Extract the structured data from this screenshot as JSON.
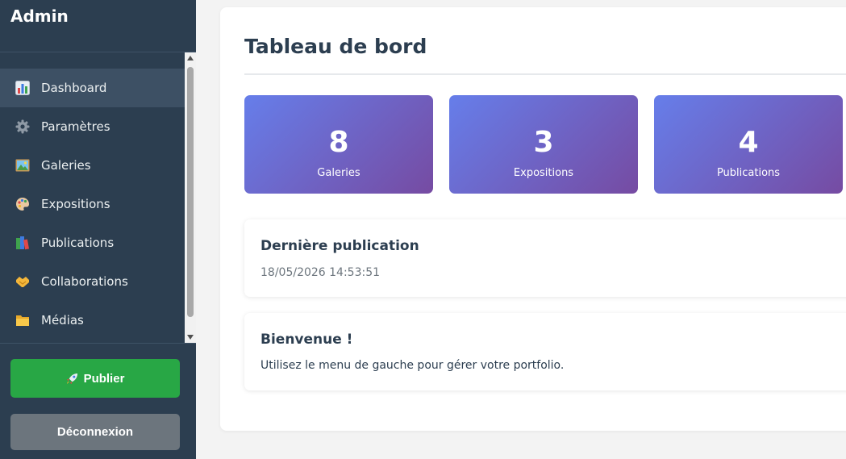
{
  "sidebar": {
    "brand": "Admin",
    "items": [
      {
        "label": "Dashboard",
        "icon": "bar-chart-icon",
        "active": true
      },
      {
        "label": "Paramètres",
        "icon": "gear-icon",
        "active": false
      },
      {
        "label": "Galeries",
        "icon": "picture-icon",
        "active": false
      },
      {
        "label": "Expositions",
        "icon": "palette-icon",
        "active": false
      },
      {
        "label": "Publications",
        "icon": "books-icon",
        "active": false
      },
      {
        "label": "Collaborations",
        "icon": "handshake-icon",
        "active": false
      },
      {
        "label": "Médias",
        "icon": "folder-icon",
        "active": false
      }
    ],
    "publish_label": "Publier",
    "publish_icon": "rocket-icon",
    "logout_label": "Déconnexion"
  },
  "main": {
    "title": "Tableau de bord",
    "stats": [
      {
        "value": "8",
        "label": "Galeries"
      },
      {
        "value": "3",
        "label": "Expositions"
      },
      {
        "value": "4",
        "label": "Publications"
      }
    ],
    "last_publication": {
      "title": "Dernière publication",
      "date": "18/05/2026 14:53:51"
    },
    "welcome": {
      "title": "Bienvenue !",
      "text": "Utilisez le menu de gauche pour gérer votre portfolio."
    }
  },
  "colors": {
    "sidebar_bg": "#2c3e50",
    "sidebar_active": "#3d5064",
    "publish_green": "#28a745",
    "logout_gray": "#6c757d",
    "gradient_start": "#667eea",
    "gradient_end": "#764ba2",
    "page_bg": "#f3f3f3"
  }
}
